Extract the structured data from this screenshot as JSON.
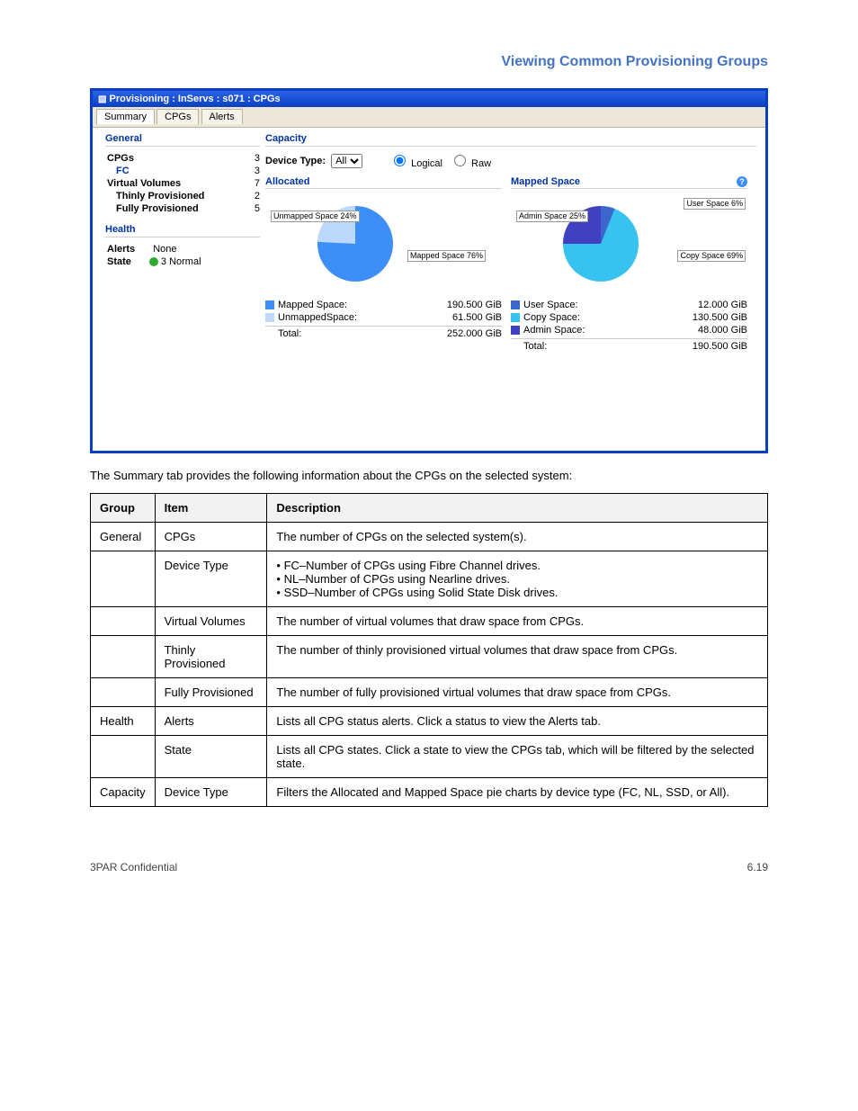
{
  "doc_title": "Viewing Common Provisioning Groups",
  "window": {
    "title": "Provisioning : InServs : s071 : CPGs"
  },
  "tabs": [
    {
      "label": "Summary",
      "active": true
    },
    {
      "label": "CPGs",
      "active": false
    },
    {
      "label": "Alerts",
      "active": false
    }
  ],
  "general": {
    "heading": "General",
    "rows": [
      {
        "k": "CPGs",
        "v": "3",
        "style": "bold"
      },
      {
        "k": "FC",
        "v": "3",
        "style": "link"
      },
      {
        "k": "Virtual Volumes",
        "v": "7",
        "style": "bold"
      },
      {
        "k": "Thinly Provisioned",
        "v": "2",
        "style": "indent"
      },
      {
        "k": "Fully Provisioned",
        "v": "5",
        "style": "indent"
      }
    ],
    "health_heading": "Health",
    "alerts_label": "Alerts",
    "alerts_value": "None",
    "state_label": "State",
    "state_value": "3 Normal"
  },
  "capacity": {
    "heading": "Capacity",
    "device_type_label": "Device Type:",
    "device_type_value": "All",
    "radio_logical": "Logical",
    "radio_raw": "Raw",
    "allocated": {
      "heading": "Allocated",
      "callouts": {
        "unmapped": "Unmapped\nSpace\n24%",
        "mapped": "Mapped\nSpace\n76%"
      },
      "legend": [
        {
          "label": "Mapped Space:",
          "value": "190.500 GiB",
          "color": "#3d8ef7"
        },
        {
          "label": "UnmappedSpace:",
          "value": "61.500 GiB",
          "color": "#bcd9fb"
        }
      ],
      "total_label": "Total:",
      "total_value": "252.000 GiB"
    },
    "mapped": {
      "heading": "Mapped Space",
      "callouts": {
        "admin": "Admin\nSpace\n25%",
        "user": "User\nSpace\n6%",
        "copy": "Copy\nSpace\n69%"
      },
      "legend": [
        {
          "label": "User Space:",
          "value": "12.000 GiB",
          "color": "#3d66cc"
        },
        {
          "label": "Copy Space:",
          "value": "130.500 GiB",
          "color": "#37c2ef"
        },
        {
          "label": "Admin Space:",
          "value": "48.000 GiB",
          "color": "#4040c0"
        }
      ],
      "total_label": "Total:",
      "total_value": "190.500 GiB"
    }
  },
  "chart_data": [
    {
      "type": "pie",
      "title": "Allocated",
      "series": [
        {
          "name": "Mapped Space",
          "value": 190.5,
          "pct": 76,
          "color": "#3d8ef7"
        },
        {
          "name": "Unmapped Space",
          "value": 61.5,
          "pct": 24,
          "color": "#bcd9fb"
        }
      ],
      "total": 252.0,
      "unit": "GiB"
    },
    {
      "type": "pie",
      "title": "Mapped Space",
      "series": [
        {
          "name": "User Space",
          "value": 12.0,
          "pct": 6,
          "color": "#3d66cc"
        },
        {
          "name": "Copy Space",
          "value": 130.5,
          "pct": 69,
          "color": "#37c2ef"
        },
        {
          "name": "Admin Space",
          "value": 48.0,
          "pct": 25,
          "color": "#4040c0"
        }
      ],
      "total": 190.5,
      "unit": "GiB"
    }
  ],
  "paragraph": "The Summary tab provides the following information about the CPGs on the selected system:",
  "table": {
    "headers": [
      "Group",
      "Item",
      "Description"
    ],
    "rows": [
      {
        "group": "General",
        "item": "CPGs",
        "desc": "The number of CPGs on the selected system(s)."
      },
      {
        "group": "",
        "item": "Device Type",
        "desc": "• FC–Number of CPGs using Fibre Channel drives.\n• NL–Number of CPGs using Nearline drives.\n• SSD–Number of CPGs using Solid State Disk drives."
      },
      {
        "group": "",
        "item": "Virtual Volumes",
        "desc": "The number of virtual volumes that draw space from CPGs."
      },
      {
        "group": "",
        "item": "Thinly Provisioned",
        "desc": "The number of thinly provisioned virtual volumes that draw space from CPGs."
      },
      {
        "group": "",
        "item": "Fully Provisioned",
        "desc": "The number of fully provisioned virtual volumes that draw space from CPGs."
      },
      {
        "group": "Health",
        "item": "Alerts",
        "desc": "Lists all CPG status alerts. Click a status to view the Alerts tab."
      },
      {
        "group": "",
        "item": "State",
        "desc": "Lists all CPG states. Click a state to view the CPGs tab, which will be filtered by the selected state."
      },
      {
        "group": "Capacity",
        "item": "Device Type",
        "desc": "Filters the Allocated and Mapped Space pie charts by device type (FC, NL, SSD, or All)."
      }
    ]
  },
  "footer": {
    "left": "3PAR Confidential",
    "right": "6.19"
  }
}
